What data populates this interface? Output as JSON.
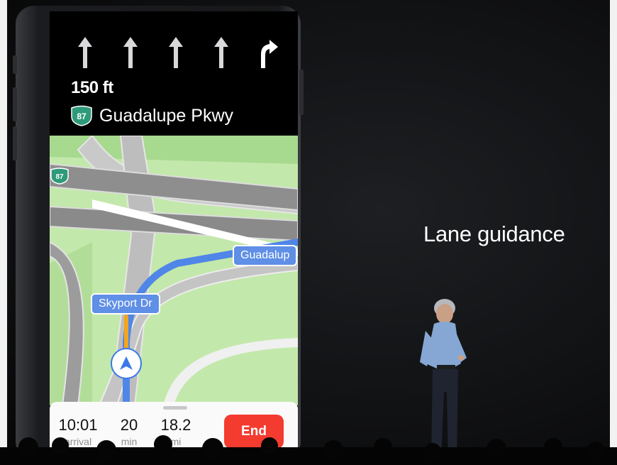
{
  "navigation": {
    "lanes": [
      {
        "direction": "straight",
        "icon": "straight-arrow-icon"
      },
      {
        "direction": "straight",
        "icon": "straight-arrow-icon"
      },
      {
        "direction": "straight",
        "icon": "straight-arrow-icon"
      },
      {
        "direction": "straight",
        "icon": "straight-arrow-icon"
      },
      {
        "direction": "right",
        "icon": "turn-right-arrow-icon"
      }
    ],
    "distance": "150 ft",
    "route_shield": "87",
    "road_name": "Guadalupe Pkwy"
  },
  "map": {
    "shield_label": "87",
    "label_guadalupe": "Guadalup",
    "label_skyport": "Skyport Dr"
  },
  "trip": {
    "arrival_value": "10:01",
    "arrival_label": "arrival",
    "duration_value": "20",
    "duration_label": "min",
    "distance_value": "18.2",
    "distance_label": "mi",
    "end_label": "End"
  },
  "slide": {
    "title": "Lane guidance"
  },
  "colors": {
    "route_blue": "#4f86e8",
    "end_red": "#f43b2f",
    "map_green": "#bfe7a8",
    "shield_green": "#2e9a7a"
  }
}
